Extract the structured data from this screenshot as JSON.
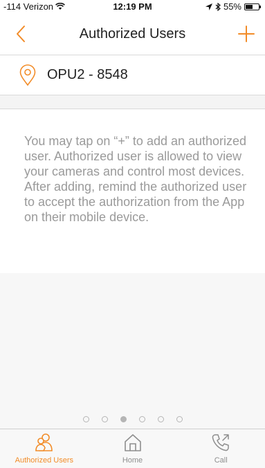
{
  "status_bar": {
    "carrier": "-114 Verizon",
    "time": "12:19 PM",
    "battery": "55%",
    "battery_level": 0.55
  },
  "nav": {
    "back_icon": "chevron-left-icon",
    "title": "Authorized Users",
    "add_icon": "plus-icon"
  },
  "location": {
    "icon": "location-pin-icon",
    "label": "OPU2 - 8548"
  },
  "info": {
    "text": "You may tap on “+” to add an authorized user. Authorized user is allowed to view your cameras and control most devices. After adding, remind the authorized user to accept the authorization from the App on their mobile device."
  },
  "pager": {
    "count": 6,
    "active_index": 2
  },
  "tabs": [
    {
      "label": "Authorized Users",
      "icon": "users-icon",
      "active": true
    },
    {
      "label": "Home",
      "icon": "home-icon",
      "active": false
    },
    {
      "label": "Call",
      "icon": "phone-call-icon",
      "active": false
    }
  ],
  "colors": {
    "accent": "#f28c28",
    "text_muted": "#9a9a9a",
    "tab_inactive": "#8e8e8e"
  }
}
